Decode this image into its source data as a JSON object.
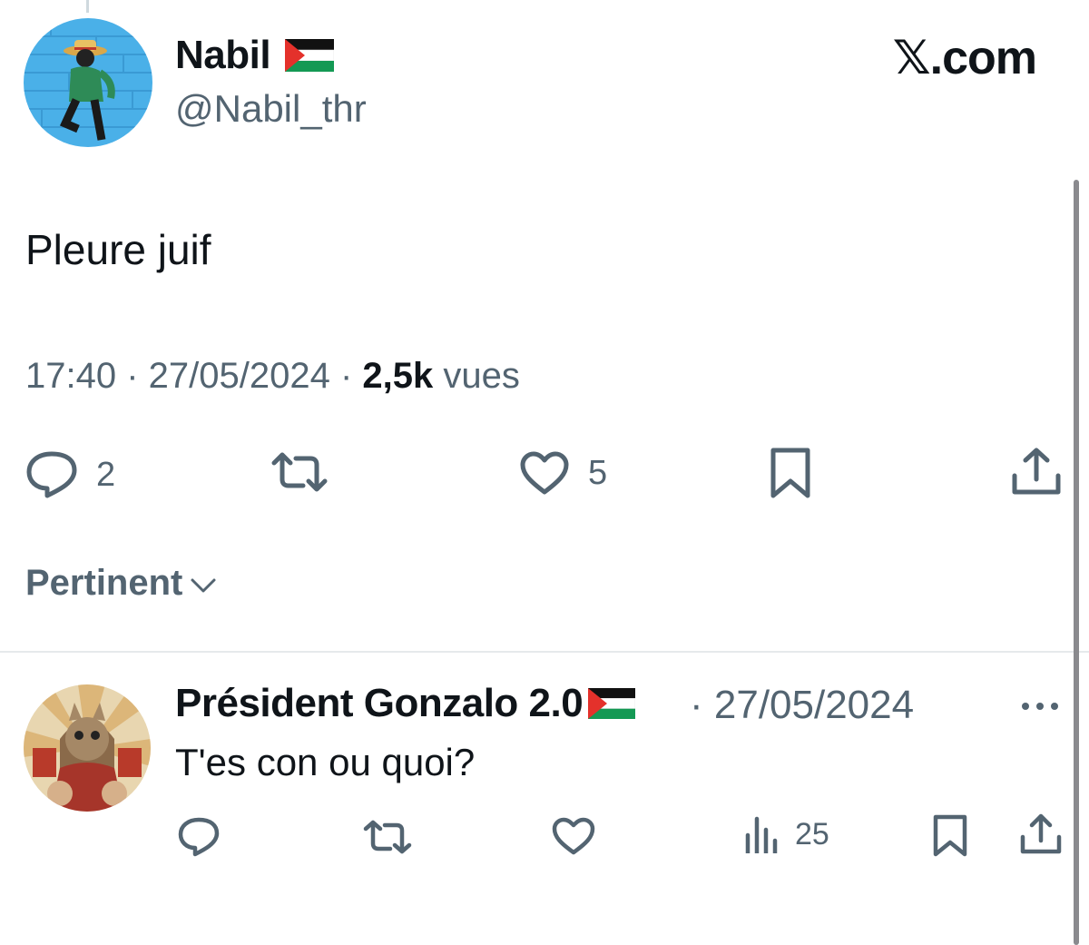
{
  "header": {
    "author_name": "Nabil",
    "author_handle": "@Nabil_thr",
    "brand": ".com",
    "brand_mark": "𝕏"
  },
  "tweet": {
    "text": "Pleure juif",
    "time": "17:40",
    "separator": " · ",
    "date": "27/05/2024",
    "views_count": "2,5k",
    "views_label": " vues"
  },
  "actions": {
    "reply_count": "2",
    "like_count": "5"
  },
  "sort": {
    "label": "Pertinent"
  },
  "reply": {
    "author_name": "Président Gonzalo 2.0",
    "date": "· 27/05/2024",
    "text": "T'es con ou quoi?",
    "views_count": "25"
  },
  "icons": {
    "reply": "speech-bubble-icon",
    "retweet": "retweet-icon",
    "like": "heart-icon",
    "bookmark": "bookmark-icon",
    "share": "share-icon",
    "views": "bar-chart-icon",
    "more": "more-dots-icon",
    "sort": "chevron-down-icon",
    "flag": "palestine-flag-icon"
  },
  "colors": {
    "text": "#0f1419",
    "secondary": "#536471",
    "divider": "#e6e9eb"
  }
}
